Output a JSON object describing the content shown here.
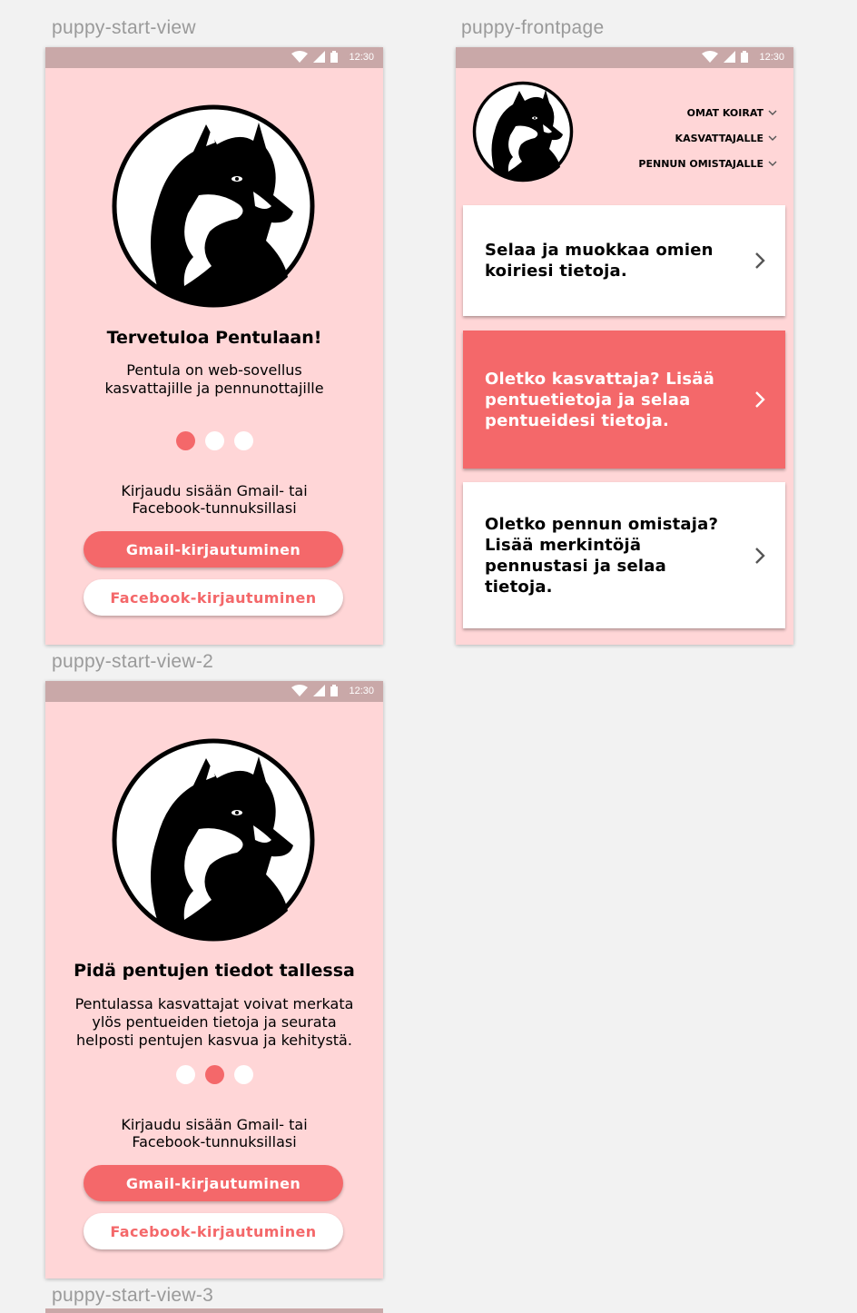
{
  "colors": {
    "pink_bg": "#ffd6d7",
    "accent": "#f4686a",
    "status_bar": "#c9a8a8",
    "white": "#ffffff"
  },
  "labels": {
    "start_view": "puppy-start-view",
    "frontpage": "puppy-frontpage",
    "start_view_2": "puppy-start-view-2",
    "start_view_3": "puppy-start-view-3"
  },
  "status": {
    "time": "12:30",
    "icons": [
      "wifi-icon",
      "signal-icon",
      "battery-icon"
    ]
  },
  "start_view": {
    "title": "Tervetuloa Pentulaan!",
    "subtitle_line1": "Pentula on web-sovellus",
    "subtitle_line2": "kasvattajille ja pennunottajille",
    "active_dot": 1,
    "login_line1": "Kirjaudu sisään Gmail- tai",
    "login_line2": "Facebook-tunnuksillasi",
    "gmail_button": "Gmail-kirjautuminen",
    "facebook_button": "Facebook-kirjautuminen"
  },
  "start_view_2": {
    "title": "Pidä pentujen tiedot tallessa",
    "subtitle_line1": "Pentulassa kasvattajat voivat merkata",
    "subtitle_line2": "ylös pentueiden tietoja ja seurata",
    "subtitle_line3": "helposti pentujen kasvua ja kehitystä.",
    "active_dot": 2,
    "login_line1": "Kirjaudu sisään Gmail- tai",
    "login_line2": "Facebook-tunnuksillasi",
    "gmail_button": "Gmail-kirjautuminen",
    "facebook_button": "Facebook-kirjautuminen"
  },
  "frontpage": {
    "nav": [
      "OMAT KOIRAT",
      "KASVATTAJALLE",
      "PENNUN OMISTAJALLE"
    ],
    "cards": [
      {
        "lines": [
          "Selaa ja muokkaa omien",
          "koiriesi tietoja."
        ]
      },
      {
        "lines": [
          "Oletko kasvattaja? Lisää",
          "pentuetietoja ja selaa",
          "pentueidesi tietoja."
        ]
      },
      {
        "lines": [
          "Oletko pennun omistaja?",
          "Lisää merkintöjä",
          "pennustasi ja selaa",
          "tietoja."
        ]
      }
    ]
  }
}
